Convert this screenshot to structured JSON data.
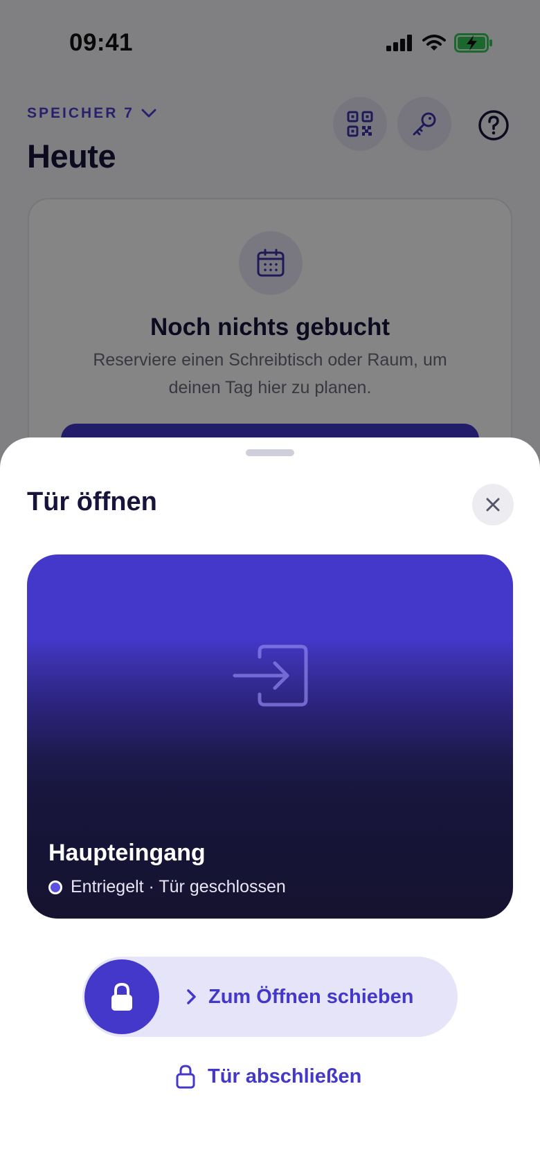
{
  "status_bar": {
    "time": "09:41"
  },
  "header": {
    "location": "SPEICHER 7",
    "title": "Heute"
  },
  "empty_state": {
    "title": "Noch nichts gebucht",
    "description": "Reserviere einen Schreibtisch oder Raum, um deinen Tag hier zu planen."
  },
  "sheet": {
    "title": "Tür öffnen",
    "door": {
      "name": "Haupteingang",
      "status": "Entriegelt · Tür geschlossen"
    },
    "slider_label": "Zum Öffnen schieben",
    "lock_label": "Tür abschließen"
  },
  "colors": {
    "accent": "#4338ca",
    "accent_light": "#e6e4f8",
    "card_dark": "#15132f",
    "battery": "#34c759"
  }
}
